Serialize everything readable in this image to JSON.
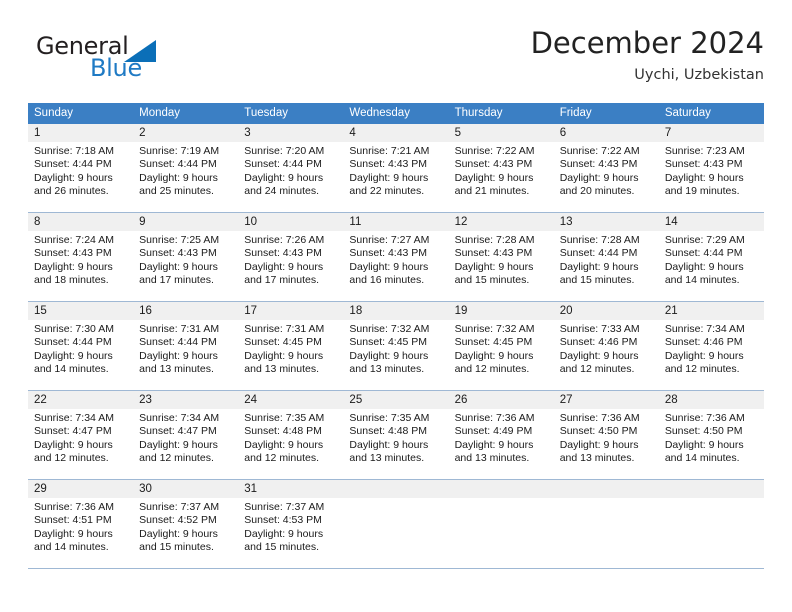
{
  "brand": {
    "name_part1": "General",
    "name_part2": "Blue",
    "triangle_icon": "triangle-icon",
    "accent_color": "#1f7ac4"
  },
  "header": {
    "title": "December 2024",
    "subtitle": "Uychi, Uzbekistan"
  },
  "calendar": {
    "header_bg": "#3b7fc4",
    "daynum_bg": "#f0f0f0",
    "weekdays": [
      "Sunday",
      "Monday",
      "Tuesday",
      "Wednesday",
      "Thursday",
      "Friday",
      "Saturday"
    ],
    "weeks": [
      {
        "days": [
          {
            "num": "1",
            "sunrise": "Sunrise: 7:18 AM",
            "sunset": "Sunset: 4:44 PM",
            "daylight1": "Daylight: 9 hours",
            "daylight2": "and 26 minutes."
          },
          {
            "num": "2",
            "sunrise": "Sunrise: 7:19 AM",
            "sunset": "Sunset: 4:44 PM",
            "daylight1": "Daylight: 9 hours",
            "daylight2": "and 25 minutes."
          },
          {
            "num": "3",
            "sunrise": "Sunrise: 7:20 AM",
            "sunset": "Sunset: 4:44 PM",
            "daylight1": "Daylight: 9 hours",
            "daylight2": "and 24 minutes."
          },
          {
            "num": "4",
            "sunrise": "Sunrise: 7:21 AM",
            "sunset": "Sunset: 4:43 PM",
            "daylight1": "Daylight: 9 hours",
            "daylight2": "and 22 minutes."
          },
          {
            "num": "5",
            "sunrise": "Sunrise: 7:22 AM",
            "sunset": "Sunset: 4:43 PM",
            "daylight1": "Daylight: 9 hours",
            "daylight2": "and 21 minutes."
          },
          {
            "num": "6",
            "sunrise": "Sunrise: 7:22 AM",
            "sunset": "Sunset: 4:43 PM",
            "daylight1": "Daylight: 9 hours",
            "daylight2": "and 20 minutes."
          },
          {
            "num": "7",
            "sunrise": "Sunrise: 7:23 AM",
            "sunset": "Sunset: 4:43 PM",
            "daylight1": "Daylight: 9 hours",
            "daylight2": "and 19 minutes."
          }
        ]
      },
      {
        "days": [
          {
            "num": "8",
            "sunrise": "Sunrise: 7:24 AM",
            "sunset": "Sunset: 4:43 PM",
            "daylight1": "Daylight: 9 hours",
            "daylight2": "and 18 minutes."
          },
          {
            "num": "9",
            "sunrise": "Sunrise: 7:25 AM",
            "sunset": "Sunset: 4:43 PM",
            "daylight1": "Daylight: 9 hours",
            "daylight2": "and 17 minutes."
          },
          {
            "num": "10",
            "sunrise": "Sunrise: 7:26 AM",
            "sunset": "Sunset: 4:43 PM",
            "daylight1": "Daylight: 9 hours",
            "daylight2": "and 17 minutes."
          },
          {
            "num": "11",
            "sunrise": "Sunrise: 7:27 AM",
            "sunset": "Sunset: 4:43 PM",
            "daylight1": "Daylight: 9 hours",
            "daylight2": "and 16 minutes."
          },
          {
            "num": "12",
            "sunrise": "Sunrise: 7:28 AM",
            "sunset": "Sunset: 4:43 PM",
            "daylight1": "Daylight: 9 hours",
            "daylight2": "and 15 minutes."
          },
          {
            "num": "13",
            "sunrise": "Sunrise: 7:28 AM",
            "sunset": "Sunset: 4:44 PM",
            "daylight1": "Daylight: 9 hours",
            "daylight2": "and 15 minutes."
          },
          {
            "num": "14",
            "sunrise": "Sunrise: 7:29 AM",
            "sunset": "Sunset: 4:44 PM",
            "daylight1": "Daylight: 9 hours",
            "daylight2": "and 14 minutes."
          }
        ]
      },
      {
        "days": [
          {
            "num": "15",
            "sunrise": "Sunrise: 7:30 AM",
            "sunset": "Sunset: 4:44 PM",
            "daylight1": "Daylight: 9 hours",
            "daylight2": "and 14 minutes."
          },
          {
            "num": "16",
            "sunrise": "Sunrise: 7:31 AM",
            "sunset": "Sunset: 4:44 PM",
            "daylight1": "Daylight: 9 hours",
            "daylight2": "and 13 minutes."
          },
          {
            "num": "17",
            "sunrise": "Sunrise: 7:31 AM",
            "sunset": "Sunset: 4:45 PM",
            "daylight1": "Daylight: 9 hours",
            "daylight2": "and 13 minutes."
          },
          {
            "num": "18",
            "sunrise": "Sunrise: 7:32 AM",
            "sunset": "Sunset: 4:45 PM",
            "daylight1": "Daylight: 9 hours",
            "daylight2": "and 13 minutes."
          },
          {
            "num": "19",
            "sunrise": "Sunrise: 7:32 AM",
            "sunset": "Sunset: 4:45 PM",
            "daylight1": "Daylight: 9 hours",
            "daylight2": "and 12 minutes."
          },
          {
            "num": "20",
            "sunrise": "Sunrise: 7:33 AM",
            "sunset": "Sunset: 4:46 PM",
            "daylight1": "Daylight: 9 hours",
            "daylight2": "and 12 minutes."
          },
          {
            "num": "21",
            "sunrise": "Sunrise: 7:34 AM",
            "sunset": "Sunset: 4:46 PM",
            "daylight1": "Daylight: 9 hours",
            "daylight2": "and 12 minutes."
          }
        ]
      },
      {
        "days": [
          {
            "num": "22",
            "sunrise": "Sunrise: 7:34 AM",
            "sunset": "Sunset: 4:47 PM",
            "daylight1": "Daylight: 9 hours",
            "daylight2": "and 12 minutes."
          },
          {
            "num": "23",
            "sunrise": "Sunrise: 7:34 AM",
            "sunset": "Sunset: 4:47 PM",
            "daylight1": "Daylight: 9 hours",
            "daylight2": "and 12 minutes."
          },
          {
            "num": "24",
            "sunrise": "Sunrise: 7:35 AM",
            "sunset": "Sunset: 4:48 PM",
            "daylight1": "Daylight: 9 hours",
            "daylight2": "and 12 minutes."
          },
          {
            "num": "25",
            "sunrise": "Sunrise: 7:35 AM",
            "sunset": "Sunset: 4:48 PM",
            "daylight1": "Daylight: 9 hours",
            "daylight2": "and 13 minutes."
          },
          {
            "num": "26",
            "sunrise": "Sunrise: 7:36 AM",
            "sunset": "Sunset: 4:49 PM",
            "daylight1": "Daylight: 9 hours",
            "daylight2": "and 13 minutes."
          },
          {
            "num": "27",
            "sunrise": "Sunrise: 7:36 AM",
            "sunset": "Sunset: 4:50 PM",
            "daylight1": "Daylight: 9 hours",
            "daylight2": "and 13 minutes."
          },
          {
            "num": "28",
            "sunrise": "Sunrise: 7:36 AM",
            "sunset": "Sunset: 4:50 PM",
            "daylight1": "Daylight: 9 hours",
            "daylight2": "and 14 minutes."
          }
        ]
      },
      {
        "days": [
          {
            "num": "29",
            "sunrise": "Sunrise: 7:36 AM",
            "sunset": "Sunset: 4:51 PM",
            "daylight1": "Daylight: 9 hours",
            "daylight2": "and 14 minutes."
          },
          {
            "num": "30",
            "sunrise": "Sunrise: 7:37 AM",
            "sunset": "Sunset: 4:52 PM",
            "daylight1": "Daylight: 9 hours",
            "daylight2": "and 15 minutes."
          },
          {
            "num": "31",
            "sunrise": "Sunrise: 7:37 AM",
            "sunset": "Sunset: 4:53 PM",
            "daylight1": "Daylight: 9 hours",
            "daylight2": "and 15 minutes."
          },
          {
            "num": "",
            "sunrise": "",
            "sunset": "",
            "daylight1": "",
            "daylight2": ""
          },
          {
            "num": "",
            "sunrise": "",
            "sunset": "",
            "daylight1": "",
            "daylight2": ""
          },
          {
            "num": "",
            "sunrise": "",
            "sunset": "",
            "daylight1": "",
            "daylight2": ""
          },
          {
            "num": "",
            "sunrise": "",
            "sunset": "",
            "daylight1": "",
            "daylight2": ""
          }
        ]
      }
    ]
  }
}
